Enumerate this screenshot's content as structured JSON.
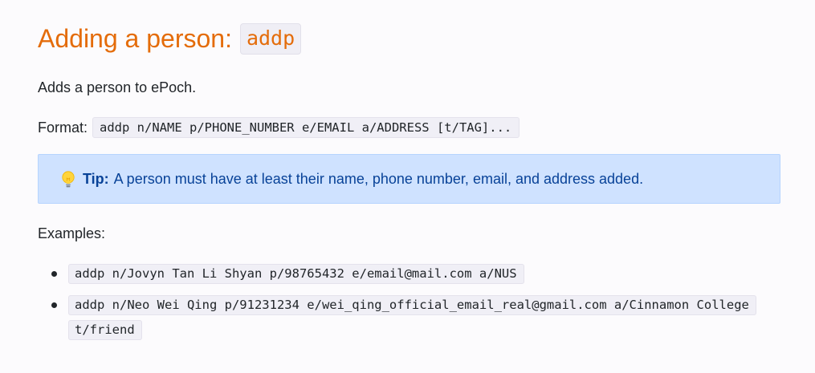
{
  "heading": {
    "text": "Adding a person:",
    "command": "addp"
  },
  "description": "Adds a person to ePoch.",
  "format": {
    "label": "Format:",
    "syntax": "addp n/NAME p/PHONE_NUMBER e/EMAIL a/ADDRESS [t/TAG]..."
  },
  "tip": {
    "icon": "lightbulb-icon",
    "label": "Tip:",
    "text": "A person must have at least their name, phone number, email, and address added."
  },
  "examples": {
    "label": "Examples:",
    "items": [
      "addp n/Jovyn Tan Li Shyan p/98765432 e/email@mail.com a/NUS",
      "addp n/Neo Wei Qing p/91231234 e/wei_qing_official_email_real@gmail.com a/Cinnamon College t/friend"
    ]
  },
  "colors": {
    "heading": "#e46c0a",
    "tip_background": "#cfe2ff",
    "tip_text": "#084298"
  }
}
